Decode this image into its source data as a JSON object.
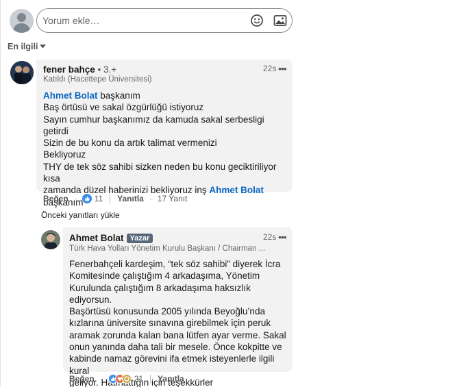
{
  "composer": {
    "placeholder": "Yorum ekle…",
    "emoji_icon": "smile-icon",
    "image_icon": "image-icon"
  },
  "sort": {
    "label": "En ilgili"
  },
  "comment": {
    "author": "fener bahçe",
    "degree": "• 3.+",
    "headline": "Katıldı (Hacettepe Üniversitesi)",
    "time": "22s",
    "mention": "Ahmet Bolat",
    "first_line_rest": " başkanım",
    "lines": [
      "Baş örtüsü ve sakal özgürlüğü istiyoruz",
      "Sayın cumhur başkanımız da kamuda sakal serbesligi getirdi",
      "Sizin de bu konu da artık talimat vermenizi",
      "Bekliyoruz",
      "THY de tek söz sahibi sizken neden bu konu geciktiriliyor kısa",
      "zamanda düzel haberinizi bekliyoruz inş"
    ],
    "last_line": "başkanım",
    "actions": {
      "like": "Beğen",
      "sep": "·",
      "reactions": "11",
      "reply": "Yanıtla",
      "replies": "17 Yanıt"
    }
  },
  "load_previous": "Önceki yanıtları yükle",
  "reply": {
    "author": "Ahmet Bolat",
    "badge": "Yazar",
    "headline": "Türk Hava Yolları Yönetim Kurulu Başkanı / Chairman ...",
    "time": "22s",
    "lines": [
      "Fenerbahçeli kardeşim, “tek söz sahibi” diyerek İcra",
      "Komitesinde çalıştığım 4 arkadaşıma, Yönetim",
      "Kurulunda çalıştığım 8 arkadaşıma haksızlık ediyorsun.",
      "Başörtüsü konusunda 2005 yılında Beyoğlu’nda",
      "kızlarına üniversite sınavına girebilmek için peruk",
      "aramak zorunda kalan bana lütfen ayar verme. Sakal",
      "onun yanında daha tali bir mesele. Önce kokpitte ve",
      "kabinde namaz görevini ifa etmek isteyenlerle ilgili kural",
      "geliyor. Hatırlattığın için teşekkürler"
    ],
    "actions": {
      "like": "Beğen",
      "sep": "·",
      "reactions": "21",
      "reply": "Yanıtla"
    }
  },
  "colors": {
    "link": "#0a66c2",
    "bubble": "#f2f2f2",
    "like_blue": "#378fe9",
    "love_red": "#df704d",
    "celebrate": "#d1a84e"
  }
}
